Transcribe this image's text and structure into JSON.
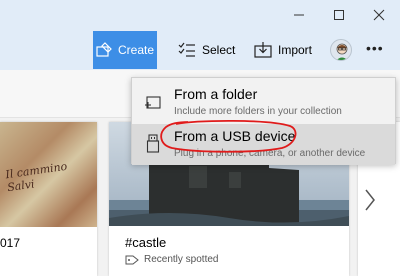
{
  "window": {
    "controls": [
      "minimize",
      "maximize",
      "close"
    ]
  },
  "toolbar": {
    "create_label": "Create",
    "select_label": "Select",
    "import_label": "Import",
    "more_label": "•••"
  },
  "cards": [
    {
      "caption": "017"
    },
    {
      "title": "#castle",
      "subtitle": "Recently spotted"
    }
  ],
  "menu": {
    "items": [
      {
        "title": "From a folder",
        "description": "Include more folders in your collection"
      },
      {
        "title": "From a USB device",
        "description": "Plug in a phone, camera, or another device"
      }
    ]
  },
  "colors": {
    "toolbar_bg": "#e1ecf8",
    "accent": "#3d8ee6",
    "annotation": "#e01b1b"
  }
}
